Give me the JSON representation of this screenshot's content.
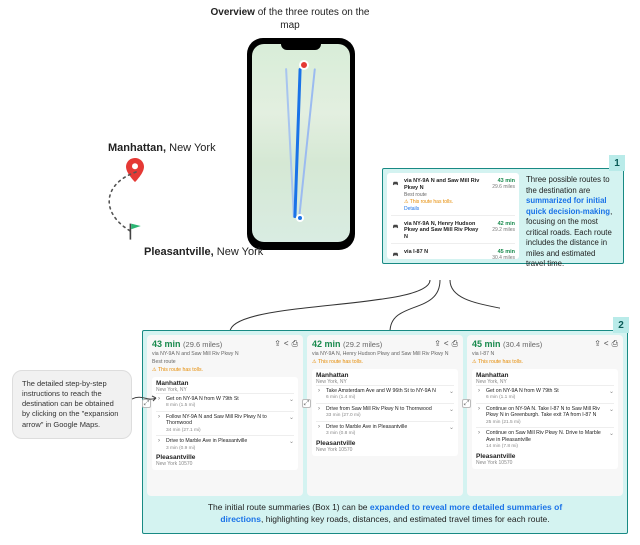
{
  "overview_caption_pre": "Overview",
  "overview_caption_post": " of the three routes on the map",
  "origin": {
    "bold": "Manhattan,",
    "rest": " New York"
  },
  "destination": {
    "bold": "Pleasantville,",
    "rest": " New York"
  },
  "box1": {
    "badge": "1",
    "explain_pre": "Three possible routes to the destination are ",
    "explain_hl": "summarized for initial quick decision-making",
    "explain_post": ", focusing on the most critical roads. Each route includes the distance in miles and estimated travel time.",
    "routes": [
      {
        "name": "via NY-9A N and Saw Mill Riv Pkwy N",
        "sub": "Best route",
        "toll": "This route has tolls.",
        "details": "Details",
        "time": "43 min",
        "dist": "29.6 miles"
      },
      {
        "name": "via NY-9A N, Henry Hudson Pkwy and Saw Mill Riv Pkwy N",
        "time": "42 min",
        "dist": "29.2 miles"
      },
      {
        "name": "via I-87 N",
        "time": "45 min",
        "dist": "30.4 miles"
      }
    ]
  },
  "box2": {
    "badge": "2",
    "footer_pre": "The initial route summaries (Box 1) can be ",
    "footer_hl": "expanded to reveal more detailed summaries of directions",
    "footer_post": ", highlighting key roads, distances, and estimated travel times for each route.",
    "cards": [
      {
        "time": "43 min",
        "miles": "(29.6 miles)",
        "via": "via NY-9A N and Saw Mill Riv Pkwy N",
        "sub": "Best route",
        "toll": "This route has tolls.",
        "origin_name": "Manhattan",
        "origin_sub": "New York, NY",
        "dest_name": "Pleasantville",
        "dest_sub": "New York 10570",
        "steps": [
          {
            "text": "Get on NY-9A N from W 79th St",
            "meta": "8 min (1.5 mi)"
          },
          {
            "text": "Follow NY-9A N and Saw Mill Riv Pkwy N to Thornwood",
            "meta": "34 min (27.1 mi)"
          },
          {
            "text": "Drive to Marble Ave in Pleasantville",
            "meta": "3 min (0.9 mi)"
          }
        ]
      },
      {
        "time": "42 min",
        "miles": "(29.2 miles)",
        "via": "via NY-9A N, Henry Hudson Pkwy and Saw Mill Riv Pkwy N",
        "toll": "This route has tolls.",
        "origin_name": "Manhattan",
        "origin_sub": "New York, NY",
        "dest_name": "Pleasantville",
        "dest_sub": "New York 10570",
        "steps": [
          {
            "text": "Take Amsterdam Ave and W 96th St to NY-9A N",
            "meta": "6 min (1.4 mi)"
          },
          {
            "text": "Drive from Saw Mill Riv Pkwy N to Thornwood",
            "meta": "33 min (27.0 mi)"
          },
          {
            "text": "Drive to Marble Ave in Pleasantville",
            "meta": "3 min (0.8 mi)"
          }
        ]
      },
      {
        "time": "45 min",
        "miles": "(30.4 miles)",
        "via": "via I-87 N",
        "toll": "This route has tolls.",
        "origin_name": "Manhattan",
        "origin_sub": "New York, NY",
        "dest_name": "Pleasantville",
        "dest_sub": "New York 10570",
        "steps": [
          {
            "text": "Get on NY-9A N from W 79th St",
            "meta": "6 min (1.1 mi)"
          },
          {
            "text": "Continue on NY-9A N. Take I-87 N to Saw Mill Riv Pkwy N in Greenburgh. Take exit 7A from I-87 N",
            "meta": "25 min (21.5 mi)"
          },
          {
            "text": "Continue on Saw Mill Riv Pkwy N. Drive to Marble Ave in Pleasantville",
            "meta": "14 min (7.8 mi)"
          }
        ]
      }
    ]
  },
  "bubble": "The detailed step-by-step instructions to reach the destination can be obtained by clicking on the \"expansion arrow\" in Google Maps."
}
